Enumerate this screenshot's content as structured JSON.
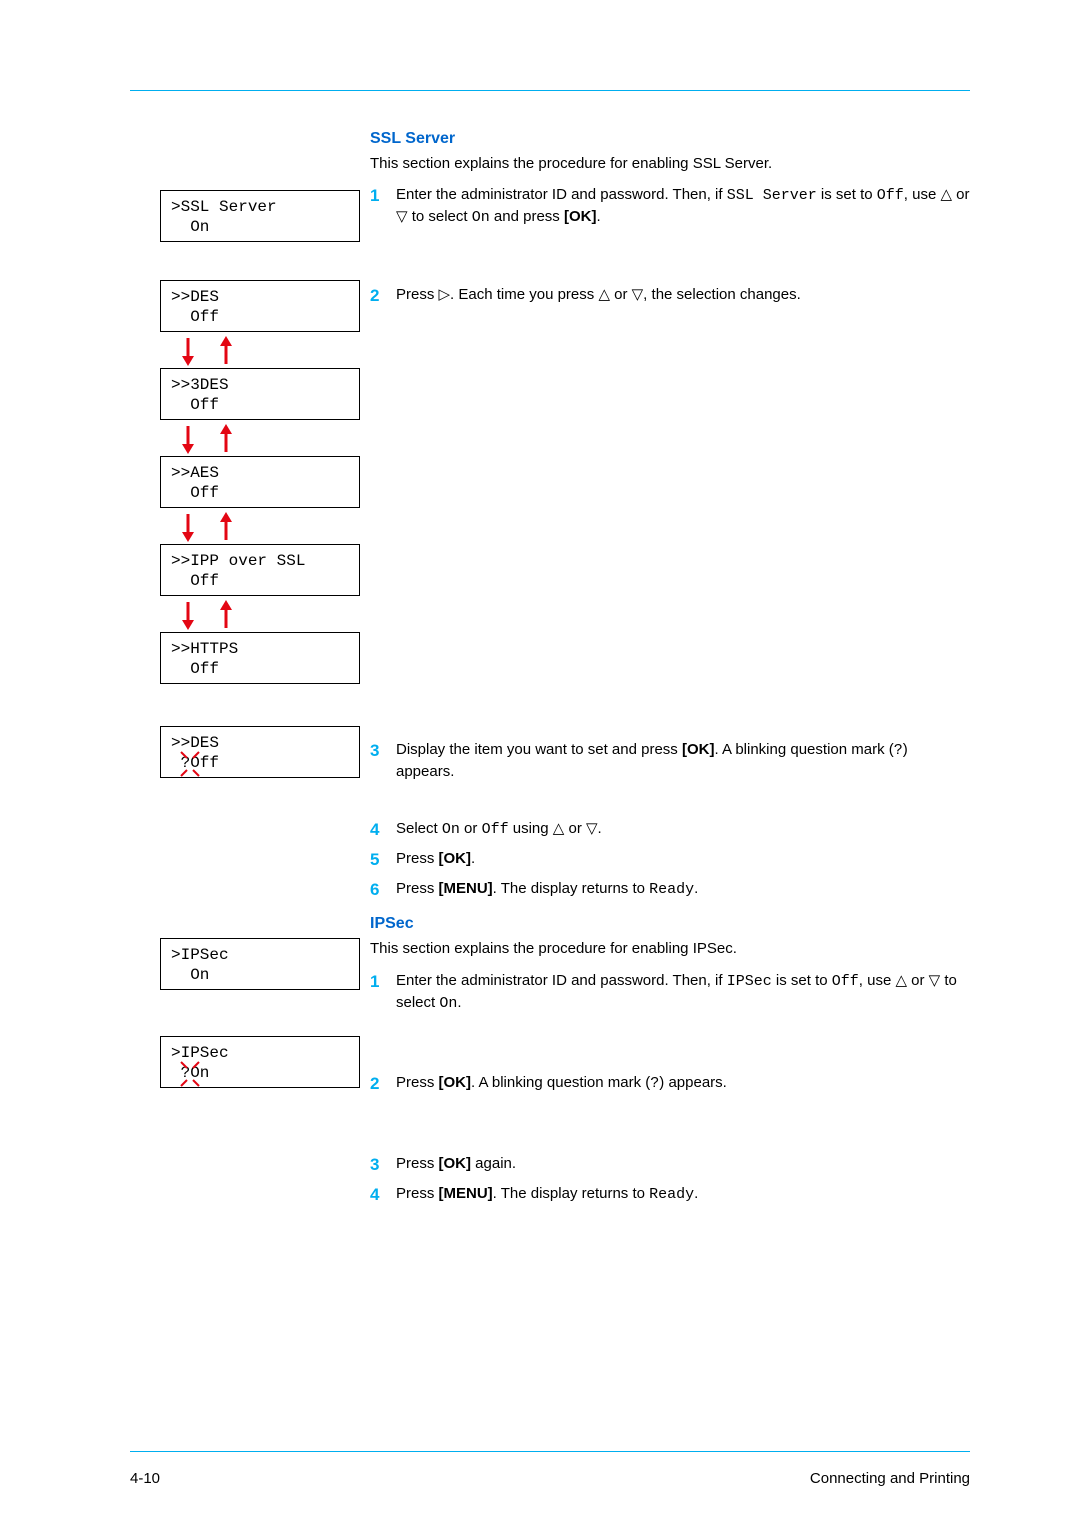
{
  "page": {
    "footer_left": "4-10",
    "footer_right": "Connecting and Printing"
  },
  "ssl": {
    "heading": "SSL Server",
    "intro": "This section explains the procedure for enabling SSL Server.",
    "step1_a": "Enter the administrator ID and password. Then, if ",
    "step1_code1": "SSL Server",
    "step1_b": " is set to ",
    "step1_code2": "Off",
    "step1_c": ", use △ or ▽ to select ",
    "step1_code3": "On",
    "step1_d": " and press ",
    "step1_bold": "[OK]",
    "step1_e": ".",
    "step2": "Press ▷. Each time you press △ or ▽, the selection changes.",
    "step3_a": "Display the item you want to set and press ",
    "step3_bold": "[OK]",
    "step3_b": ". A blinking question mark (",
    "step3_code": "?",
    "step3_c": ") appears.",
    "step4_a": "Select ",
    "step4_code1": "On",
    "step4_b": " or ",
    "step4_code2": "Off",
    "step4_c": " using △ or ▽.",
    "step5_a": "Press ",
    "step5_bold": "[OK]",
    "step5_b": ".",
    "step6_a": "Press ",
    "step6_bold": "[MENU]",
    "step6_b": ". The display returns to ",
    "step6_code": "Ready",
    "step6_c": "."
  },
  "ipsec": {
    "heading": "IPSec",
    "intro": "This section explains the procedure for enabling IPSec.",
    "step1_a": "Enter the administrator ID and password. Then, if ",
    "step1_code1": "IPSec",
    "step1_b": " is set to ",
    "step1_code2": "Off",
    "step1_c": ", use △ or ▽ to select ",
    "step1_code3": "On",
    "step1_d": ".",
    "step2_a": "Press ",
    "step2_bold": "[OK]",
    "step2_b": ". A blinking question mark (",
    "step2_code": "?",
    "step2_c": ") appears.",
    "step3_a": "Press ",
    "step3_bold": "[OK]",
    "step3_b": " again.",
    "step4_a": "Press ",
    "step4_bold": "[MENU]",
    "step4_b": ". The display returns to ",
    "step4_code": "Ready",
    "step4_c": "."
  },
  "lcd": {
    "ssl_server_l1": ">SSL Server",
    "ssl_server_l2": "  On",
    "des_l1": ">>DES",
    "des_l2": "  Off",
    "tdes_l1": ">>3DES",
    "tdes_l2": "  Off",
    "aes_l1": ">>AES",
    "aes_l2": "  Off",
    "ipp_l1": ">>IPP over SSL",
    "ipp_l2": "  Off",
    "https_l1": ">>HTTPS",
    "https_l2": "  Off",
    "desq_l1": ">>DES",
    "desq_l2": " ?Off",
    "ipsec_l1": ">IPSec",
    "ipsec_l2": "  On",
    "ipsecq_l1": ">IPSec",
    "ipsecq_l2": " ?On"
  }
}
